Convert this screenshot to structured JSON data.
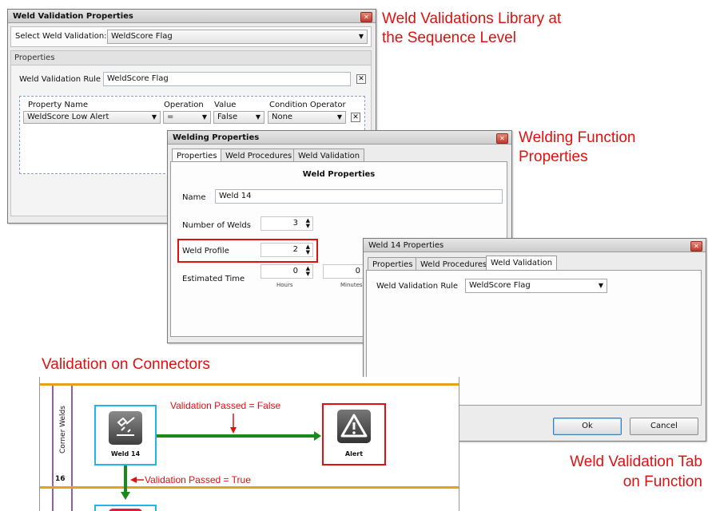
{
  "callouts": {
    "library_line1": "Weld Validations Library at",
    "library_line2": "the Sequence Level",
    "function_line1": "Welding Function",
    "function_line2": "Properties",
    "connectors": "Validation on Connectors",
    "tab_line1": "Weld Validation Tab",
    "tab_line2": "on Function"
  },
  "validation_window": {
    "title": "Weld Validation Properties",
    "select_label": "Select Weld Validation:",
    "select_value": "WeldScore Flag",
    "properties_header": "Properties",
    "rule_label": "Weld Validation Rule",
    "rule_value": "WeldScore Flag",
    "columns": [
      "Property Name",
      "Operation",
      "Value",
      "Condition Operator"
    ],
    "row": {
      "property": "WeldScore Low Alert",
      "operation": "=",
      "value": "False",
      "condition": "None"
    }
  },
  "welding_window": {
    "title": "Welding Properties",
    "tabs": [
      "Properties",
      "Weld Procedures",
      "Weld Validation"
    ],
    "section_title": "Weld Properties",
    "name_label": "Name",
    "name_value": "Weld 14",
    "num_welds_label": "Number of Welds",
    "num_welds_value": "3",
    "profile_label": "Weld Profile",
    "profile_value": "2",
    "est_time_label": "Estimated Time",
    "hours_value": "0",
    "hours_label": "Hours",
    "minutes_value": "0",
    "minutes_label": "Minutes"
  },
  "weld14_window": {
    "title": "Weld 14 Properties",
    "tabs": [
      "Properties",
      "Weld Procedures",
      "Weld Validation"
    ],
    "rule_label": "Weld Validation Rule",
    "rule_value": "WeldScore Flag",
    "ok_label": "Ok",
    "cancel_label": "Cancel"
  },
  "diagram": {
    "lane_label": "Corner Welds",
    "lane_number": "16",
    "weld_node_label": "Weld 14",
    "alert_node_label": "Alert",
    "pass_false_label": "Validation Passed = False",
    "pass_true_label": "Validation Passed = True"
  },
  "colors": {
    "callout_red": "#e01010",
    "connector_green": "#1a8a1a",
    "lane_orange": "#e3a21a",
    "node_blue": "#23b5e8"
  }
}
